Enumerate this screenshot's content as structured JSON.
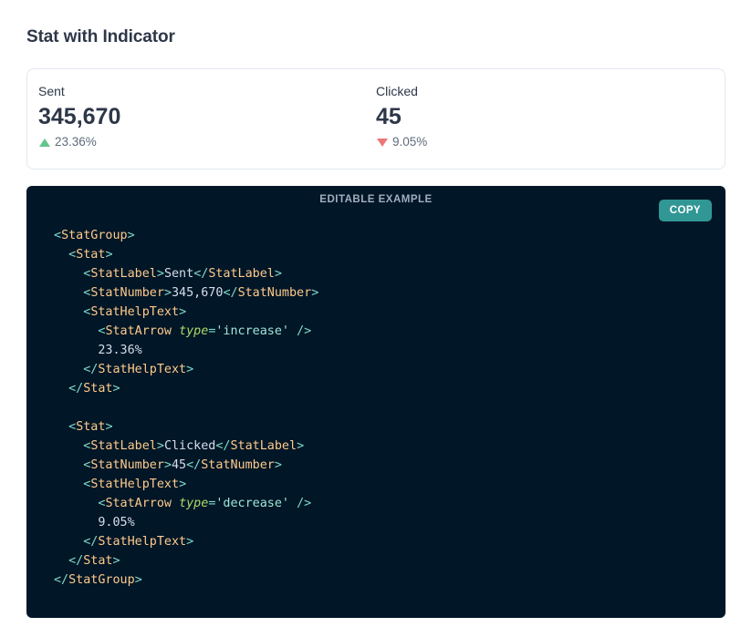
{
  "section": {
    "title": "Stat with Indicator"
  },
  "stats": [
    {
      "label": "Sent",
      "number": "345,670",
      "help": "23.36%",
      "arrow": "increase",
      "arrow_icon": "triangle-up-icon",
      "arrow_color": "#48bb78"
    },
    {
      "label": "Clicked",
      "number": "45",
      "help": "9.05%",
      "arrow": "decrease",
      "arrow_icon": "triangle-down-icon",
      "arrow_color": "#e53e3e"
    }
  ],
  "code_panel": {
    "heading": "EDITABLE EXAMPLE",
    "copy_label": "COPY",
    "background": "#011627",
    "copy_color": "#319795"
  },
  "code": {
    "t_statgroup": "StatGroup",
    "t_stat": "Stat",
    "t_label": "StatLabel",
    "t_number": "StatNumber",
    "t_help": "StatHelpText",
    "t_arrow": "StatArrow",
    "attr_type": "type",
    "v_increase": "'increase'",
    "v_decrease": "'decrease'",
    "sent": "Sent",
    "num1": "345,670",
    "pct1": "23.36%",
    "clicked": "Clicked",
    "num2": "45",
    "pct2": "9.05%"
  }
}
